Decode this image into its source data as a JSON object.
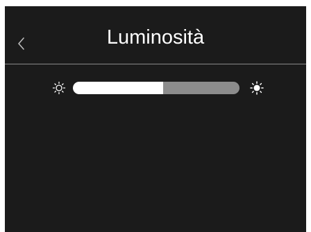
{
  "header": {
    "title": "Luminosità",
    "back_icon": "chevron-left-icon"
  },
  "brightness": {
    "level_percent": 54,
    "min_icon": "sun-outline-icon",
    "max_icon": "sun-filled-icon"
  },
  "colors": {
    "background": "#1b1b1b",
    "text": "#ffffff",
    "divider": "#8a8a8a",
    "slider_track": "#8c8c8c",
    "slider_fill": "#ffffff"
  }
}
